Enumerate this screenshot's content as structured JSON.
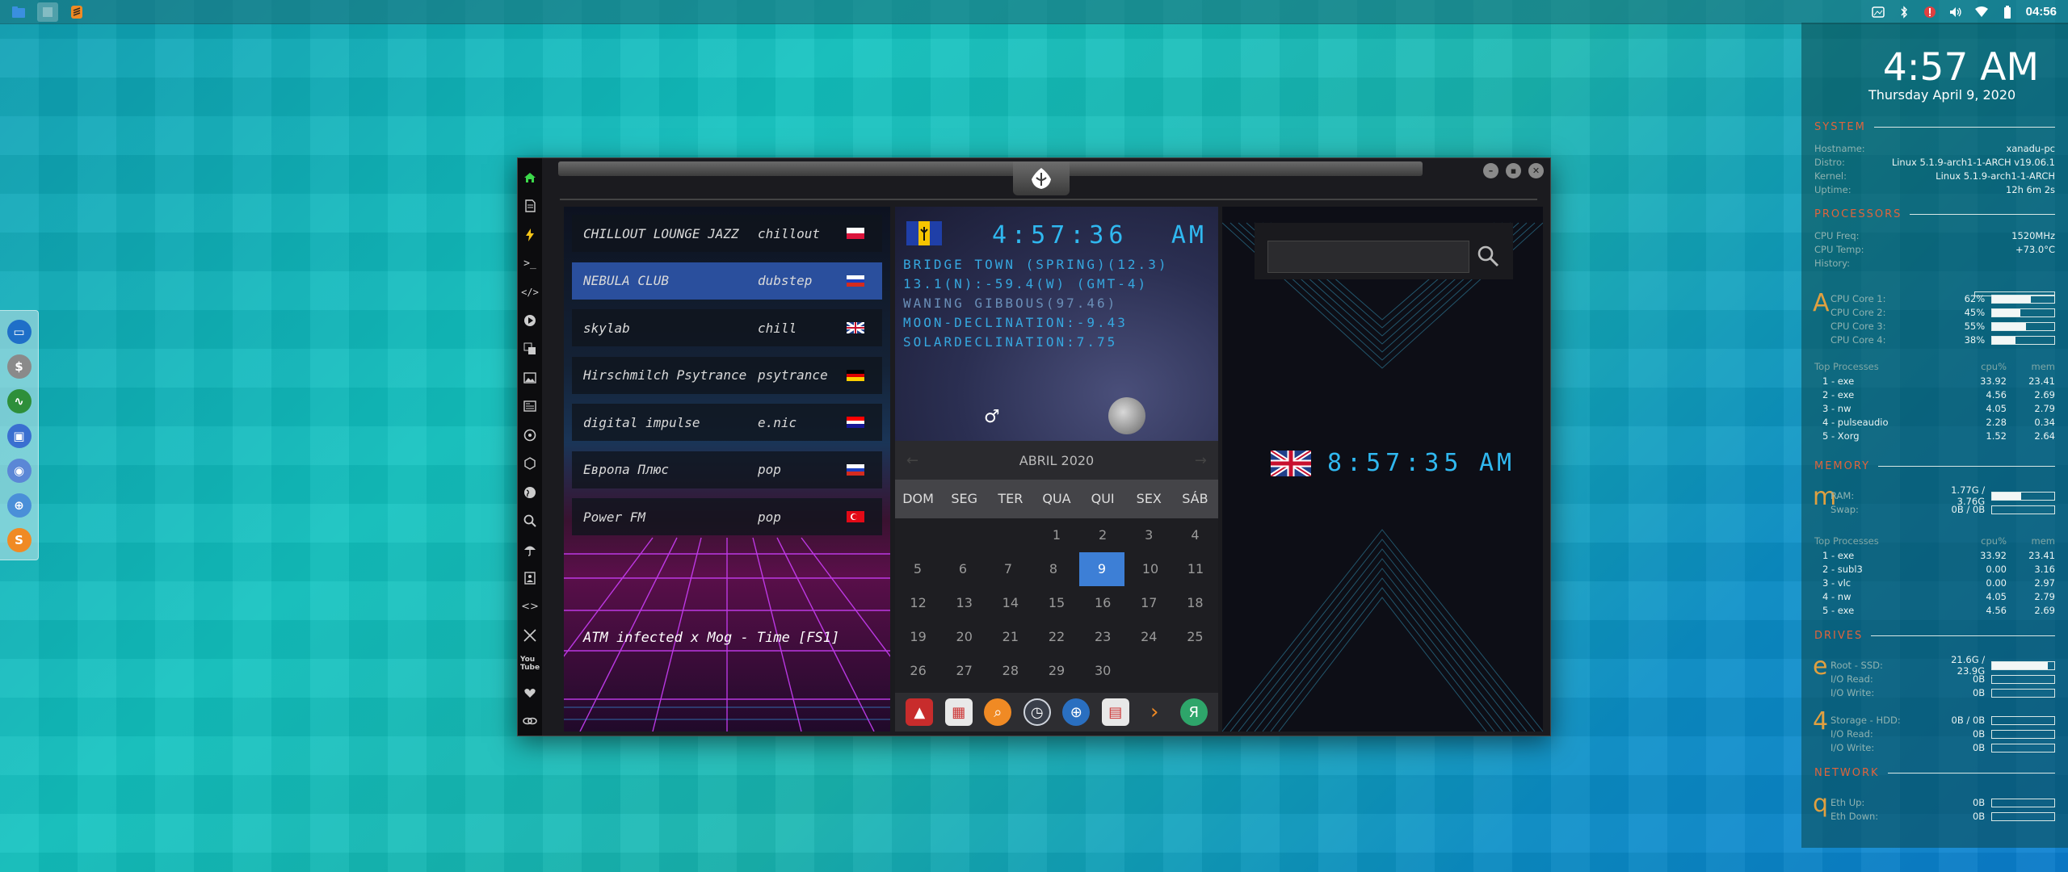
{
  "topbar": {
    "left_icons": [
      "files-icon",
      "blank-icon",
      "sublime-icon"
    ],
    "tray": [
      "screenshot-icon",
      "bluetooth-icon",
      "warning-icon",
      "volume-icon",
      "wifi-icon",
      "battery-icon"
    ],
    "clock": "04:56"
  },
  "dock": {
    "apps": [
      {
        "name": "files-app-icon",
        "glyph": "▭",
        "color": "#1f6fc8"
      },
      {
        "name": "money-app-icon",
        "glyph": "$",
        "color": "#8a8a8a"
      },
      {
        "name": "monitor-app-icon",
        "glyph": "∿",
        "color": "#2e8f3a"
      },
      {
        "name": "screen-app-icon",
        "glyph": "▣",
        "color": "#3a6fd0"
      },
      {
        "name": "chrome-app-icon",
        "glyph": "◉",
        "color": "#5b87d6"
      },
      {
        "name": "globe-app-icon",
        "glyph": "⊕",
        "color": "#4a8fd8"
      },
      {
        "name": "sublime-app-icon",
        "glyph": "S",
        "color": "#f08a24"
      }
    ]
  },
  "conky": {
    "time": "4:57 AM",
    "date": "Thursday April  9, 2020",
    "sections": {
      "system": "SYSTEM",
      "processors": "PROCESSORS",
      "memory": "MEMORY",
      "drives": "DRIVES",
      "network": "NETWORK"
    },
    "system": [
      {
        "k": "Hostname:",
        "v": "xanadu-pc"
      },
      {
        "k": "Distro:",
        "v": "Linux 5.1.9-arch1-1-ARCH v19.06.1"
      },
      {
        "k": "Kernel:",
        "v": "Linux 5.1.9-arch1-1-ARCH"
      },
      {
        "k": "Uptime:",
        "v": "12h 6m 2s"
      }
    ],
    "cpu": [
      {
        "k": "CPU Freq:",
        "v": "1520MHz"
      },
      {
        "k": "CPU Temp:",
        "v": "+73.0°C"
      },
      {
        "k": "History:",
        "v": ""
      }
    ],
    "cpu_glyph": "A",
    "cores": [
      {
        "k": "CPU Core 1:",
        "v": "62%",
        "pct": 62
      },
      {
        "k": "CPU Core 2:",
        "v": "45%",
        "pct": 45
      },
      {
        "k": "CPU Core 3:",
        "v": "55%",
        "pct": 55
      },
      {
        "k": "CPU Core 4:",
        "v": "38%",
        "pct": 38
      }
    ],
    "top_head": {
      "n": "Top Processes",
      "a": "cpu%",
      "b": "mem"
    },
    "top_cpu": [
      {
        "n": "1 - exe",
        "a": "33.92",
        "b": "23.41"
      },
      {
        "n": "2 - exe",
        "a": "4.56",
        "b": "2.69"
      },
      {
        "n": "3 - nw",
        "a": "4.05",
        "b": "2.79"
      },
      {
        "n": "4 - pulseaudio",
        "a": "2.28",
        "b": "0.34"
      },
      {
        "n": "5 - Xorg",
        "a": "1.52",
        "b": "2.64"
      }
    ],
    "mem_glyph": "m",
    "mem": [
      {
        "k": "RAM:",
        "v": "1.77G / 3.76G",
        "pct": 47
      },
      {
        "k": "Swap:",
        "v": "0B / 0B",
        "pct": 0
      }
    ],
    "top_mem": [
      {
        "n": "1 - exe",
        "a": "33.92",
        "b": "23.41"
      },
      {
        "n": "2 - subl3",
        "a": "0.00",
        "b": "3.16"
      },
      {
        "n": "3 - vlc",
        "a": "0.00",
        "b": "2.97"
      },
      {
        "n": "4 - nw",
        "a": "4.05",
        "b": "2.79"
      },
      {
        "n": "5 - exe",
        "a": "4.56",
        "b": "2.69"
      }
    ],
    "drive1_glyph": "e",
    "drive1": [
      {
        "k": "Root  -  SSD:",
        "v": "21.6G / 23.9G",
        "pct": 90
      },
      {
        "k": "I/O Read:",
        "v": "0B",
        "pct": 0
      },
      {
        "k": "I/O Write:",
        "v": "0B",
        "pct": 0
      }
    ],
    "drive2_glyph": "4",
    "drive2": [
      {
        "k": "Storage  -  HDD:",
        "v": "0B / 0B",
        "pct": 0
      },
      {
        "k": "I/O Read:",
        "v": "0B",
        "pct": 0
      },
      {
        "k": "I/O Write:",
        "v": "0B",
        "pct": 0
      }
    ],
    "net_glyph": "q",
    "net": [
      {
        "k": "Eth Up:",
        "v": "0B",
        "pct": 0
      },
      {
        "k": "Eth Down:",
        "v": "0B",
        "pct": 0
      }
    ]
  },
  "radio": {
    "stations": [
      {
        "name": "CHILLOUT LOUNGE JAZZ",
        "genre": "chillout",
        "flag": "pl",
        "selected": false
      },
      {
        "name": "NEBULA CLUB",
        "genre": "dubstep",
        "flag": "ru",
        "selected": true
      },
      {
        "name": "skylab",
        "genre": "chill",
        "flag": "uk",
        "selected": false
      },
      {
        "name": "Hirschmilch Psytrance",
        "genre": "psytrance",
        "flag": "de",
        "selected": false
      },
      {
        "name": "digital impulse",
        "genre": "e.nic",
        "flag": "hr",
        "selected": false
      },
      {
        "name": "Европа Плюс",
        "genre": "pop",
        "flag": "ru",
        "selected": false
      },
      {
        "name": "Power FM",
        "genre": "pop",
        "flag": "tr",
        "selected": false
      }
    ],
    "now_playing": "ATM infected x Mog - Time [FS1]"
  },
  "clock": {
    "time": "4:57:36",
    "ampm": "AM",
    "astro": [
      "BRIDGE TOWN (SPRING)(12.3)",
      "13.1(N):-59.4(W) (GMT-4)",
      "WANING GIBBOUS(97.46)",
      "MOON-DECLINATION:-9.43",
      "SOLARDECLINATION:7.75"
    ]
  },
  "calendar": {
    "month": "ABRIL 2020",
    "prev": "←",
    "next": "→",
    "dows": [
      "DOM",
      "SEG",
      "TER",
      "QUA",
      "QUI",
      "SEX",
      "SÁB"
    ],
    "weeks": [
      [
        "",
        "",
        "",
        "1",
        "2",
        "3",
        "4"
      ],
      [
        "5",
        "6",
        "7",
        "8",
        "9",
        "10",
        "11"
      ],
      [
        "12",
        "13",
        "14",
        "15",
        "16",
        "17",
        "18"
      ],
      [
        "19",
        "20",
        "21",
        "22",
        "23",
        "24",
        "25"
      ],
      [
        "26",
        "27",
        "28",
        "29",
        "30",
        "",
        ""
      ]
    ],
    "today": "9"
  },
  "dock2": [
    "red-app-icon",
    "calendar-app-icon",
    "search-app-icon",
    "clock-app-icon",
    "globe-app-icon",
    "schedule-app-icon",
    "arrow-app-icon",
    "yandex-app-icon"
  ],
  "world": {
    "search_placeholder": "",
    "time": "8:57:35",
    "ampm": "AM"
  },
  "colors": {
    "accent_led": "#30b8f0",
    "conky_section": "#e0643c",
    "calendar_today": "#3d7fd6"
  }
}
